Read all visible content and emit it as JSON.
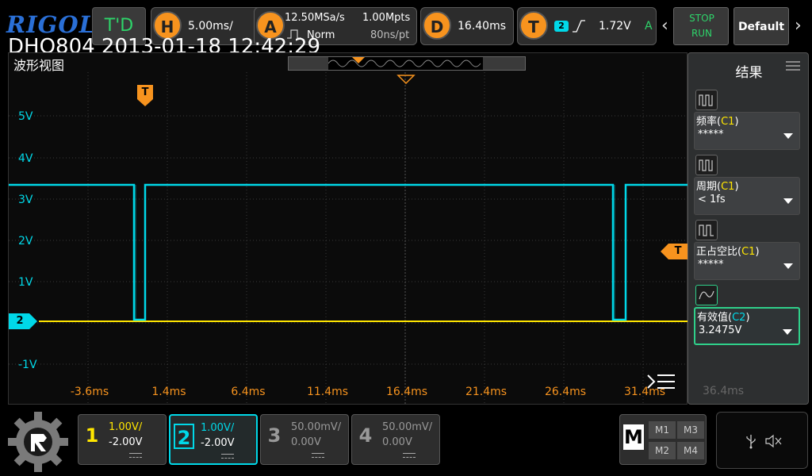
{
  "brand": "RIGOL",
  "stamp": "DHO804 2013-01-18 12:42:29",
  "top": {
    "mode": "T'D",
    "horizontal": {
      "key": "H",
      "value": "5.00ms/"
    },
    "acquire": {
      "key": "A",
      "sample_rate": "12.50MSa/s",
      "mode": "Norm",
      "depth": "1.00Mpts",
      "per_point": "80ns/pt"
    },
    "delay": {
      "key": "D",
      "value": "16.40ms"
    },
    "trigger": {
      "key": "T",
      "source": "2",
      "level": "1.72V",
      "sweep": "A"
    },
    "run_stop": {
      "stop": "STOP",
      "run": "RUN"
    },
    "default": "Default"
  },
  "wave": {
    "title": "波形视图",
    "y_labels": [
      "5V",
      "4V",
      "3V",
      "2V",
      "1V",
      "-1V"
    ],
    "x_labels": [
      "-3.6ms",
      "1.4ms",
      "6.4ms",
      "11.4ms",
      "16.4ms",
      "21.4ms",
      "26.4ms",
      "31.4ms",
      "36.4ms"
    ],
    "trigger_marker": "T",
    "ch2_marker": "2"
  },
  "results": {
    "title": "结果",
    "items": [
      {
        "name": "频率",
        "chan": "C1",
        "value": "*****"
      },
      {
        "name": "周期",
        "chan": "C1",
        "value": "< 1fs"
      },
      {
        "name": "正占空比",
        "chan": "C1",
        "value": "*****"
      },
      {
        "name": "有效值",
        "chan": "C2",
        "value": "3.2475V"
      }
    ]
  },
  "channels": [
    {
      "num": "1",
      "scale": "1.00V/",
      "offset": "-2.00V",
      "color": "#ffe600"
    },
    {
      "num": "2",
      "scale": "1.00V/",
      "offset": "-2.00V",
      "color": "#00d8e8"
    },
    {
      "num": "3",
      "scale": "50.00mV/",
      "offset": "0.00V",
      "color": "#999999"
    },
    {
      "num": "4",
      "scale": "50.00mV/",
      "offset": "0.00V",
      "color": "#999999"
    }
  ],
  "math": {
    "key": "M",
    "items": [
      "M1",
      "M3",
      "M2",
      "M4"
    ]
  }
}
